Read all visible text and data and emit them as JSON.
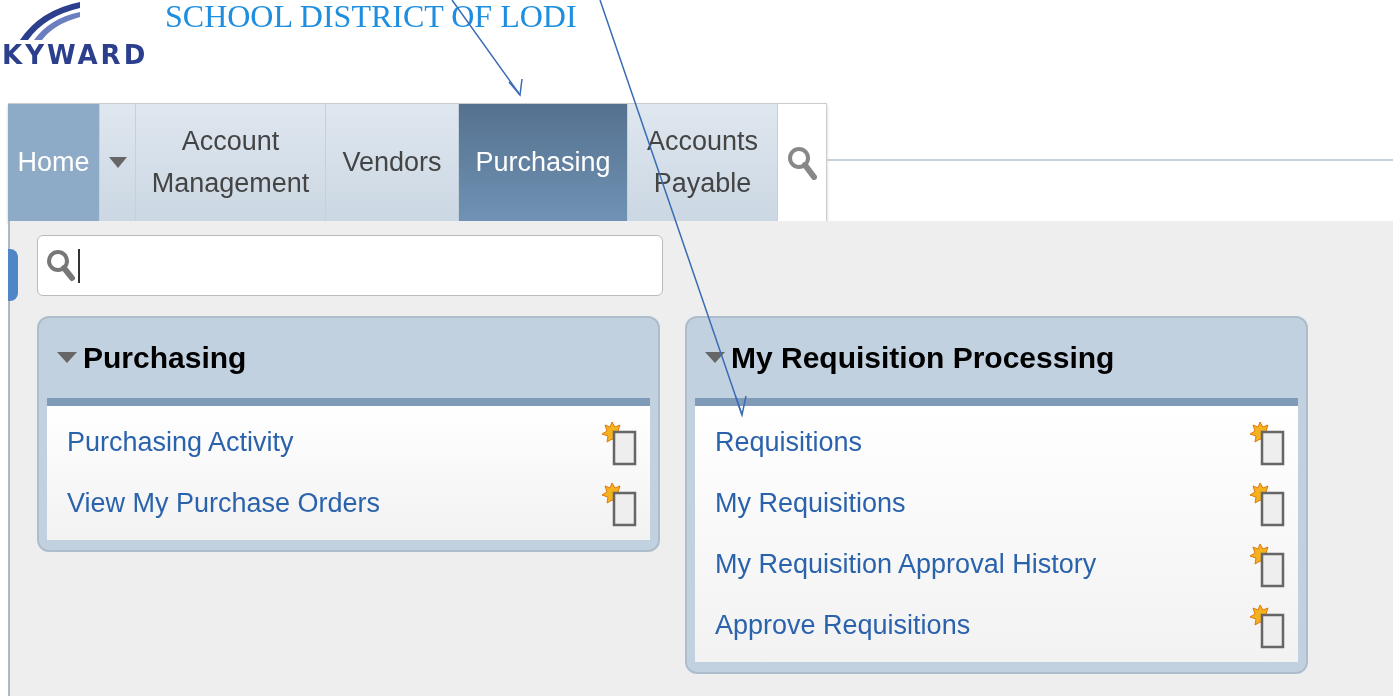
{
  "header": {
    "logo": "KYWARD",
    "district": "SCHOOL DISTRICT OF LODI"
  },
  "tabs": [
    {
      "label": "Home",
      "kind": "home",
      "selected": false
    },
    {
      "kind": "menu"
    },
    {
      "label": "Account Management",
      "kind": "module",
      "selected": false
    },
    {
      "label": "Vendors",
      "kind": "module",
      "selected": false
    },
    {
      "label": "Purchasing",
      "kind": "module",
      "selected": true
    },
    {
      "label": "Accounts Payable",
      "kind": "module",
      "selected": false
    },
    {
      "kind": "search"
    }
  ],
  "search": {
    "focused": true
  },
  "panels": [
    {
      "title": "Purchasing",
      "expanded": true,
      "links": [
        "Purchasing Activity",
        "View My Purchase Orders"
      ]
    },
    {
      "title": "My Requisition Processing",
      "expanded": true,
      "links": [
        "Requisitions",
        "My Requisitions",
        "My Requisition Approval History",
        "Approve Requisitions"
      ]
    }
  ]
}
